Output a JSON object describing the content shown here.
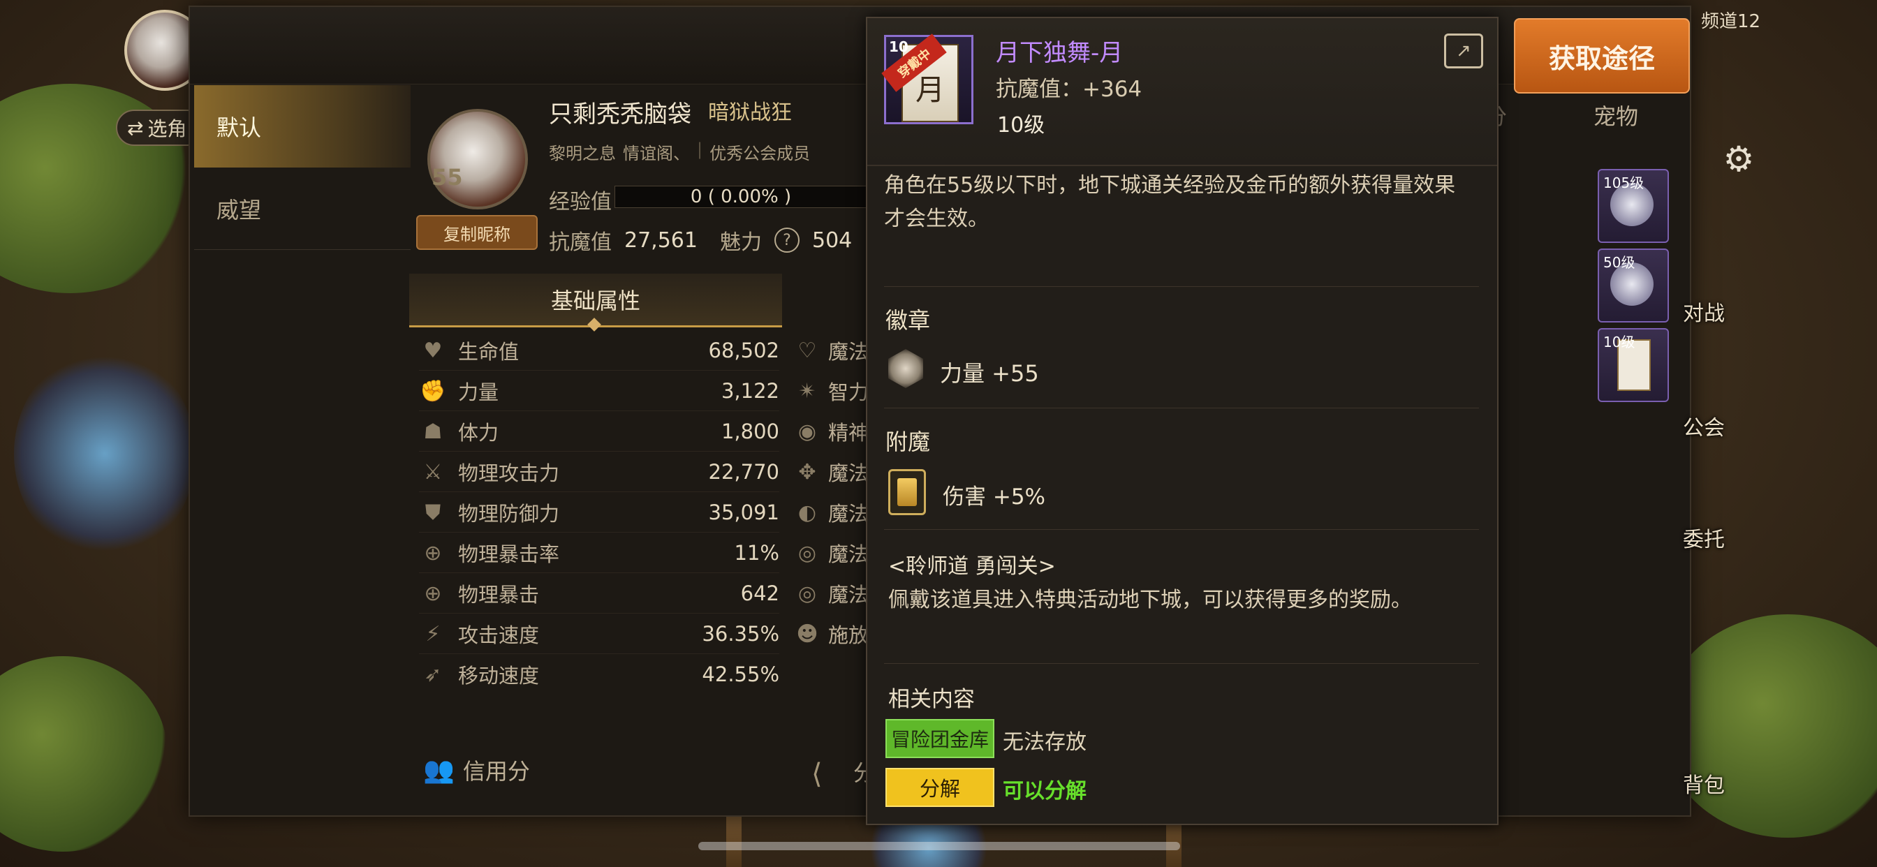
{
  "top_left": {
    "select_label": "选角"
  },
  "sidebar": {
    "tabs": [
      {
        "label": "默认"
      },
      {
        "label": "威望"
      }
    ]
  },
  "profile": {
    "level": "55",
    "copy_nickname": "复制昵称",
    "name": "只剩秃秃脑袋",
    "job": "暗狱战狂",
    "guild_info": [
      "黎明之息",
      "情谊阁、",
      "优秀公会成员"
    ],
    "exp_label": "经验值",
    "exp_value": "0 ( 0.00% )",
    "resist_label": "抗魔值",
    "resist_value": "27,561",
    "charm_label": "魅力",
    "charm_value": "504"
  },
  "attributes": {
    "tab_label": "基础属性",
    "rows": [
      {
        "label": "生命值",
        "value": "68,502",
        "icon": "heart-icon"
      },
      {
        "label": "力量",
        "value": "3,122",
        "icon": "arm-icon"
      },
      {
        "label": "体力",
        "value": "1,800",
        "icon": "person-icon"
      },
      {
        "label": "物理攻击力",
        "value": "22,770",
        "icon": "sword-icon"
      },
      {
        "label": "物理防御力",
        "value": "35,091",
        "icon": "shield-icon"
      },
      {
        "label": "物理暴击率",
        "value": "11%",
        "icon": "crosshair-icon"
      },
      {
        "label": "物理暴击",
        "value": "642",
        "icon": "crosshair-icon"
      },
      {
        "label": "攻击速度",
        "value": "36.35%",
        "icon": "attack-speed-icon"
      },
      {
        "label": "移动速度",
        "value": "42.55%",
        "icon": "boot-icon"
      }
    ],
    "right_rows": [
      "魔法",
      "智力",
      "精神",
      "魔法",
      "魔法",
      "魔法",
      "魔法",
      "施放"
    ]
  },
  "footer": {
    "credit_label": "信用分",
    "share_label": "分"
  },
  "right_panel": {
    "get_button": "获取途径",
    "channel": "频道12",
    "pet_tab": "宠物",
    "score_tab": "分",
    "slots": [
      {
        "level": "105级"
      },
      {
        "level": "50级"
      },
      {
        "level": "10级"
      }
    ],
    "side_labels": [
      "对战",
      "公会",
      "委托",
      "背包"
    ]
  },
  "tooltip": {
    "item_level_badge": "10",
    "item_ribbon": "穿戴中",
    "item_glyph": "月",
    "item_name": "月下独舞-月",
    "item_resist": "抗魔值：+364",
    "item_level": "10级",
    "description": "角色在55级以下时，地下城通关经验及金币的额外获得量效果才会生效。",
    "badge_title": "徽章",
    "badge_stat": "力量 +55",
    "enchant_title": "附魔",
    "enchant_stat": "伤害 +5%",
    "activity_title": "<聆师道 勇闯关>",
    "activity_desc": "佩戴该道具进入特典活动地下城，可以获得更多的奖励。",
    "related_title": "相关内容",
    "tag_storage": "冒险团金库",
    "tag_storage_text": "无法存放",
    "tag_disassemble": "分解",
    "tag_disassemble_text": "可以分解"
  },
  "colors": {
    "item_name": "#c28bff",
    "get_button": "#d96b1f",
    "tag_green": "#5fb82a",
    "tag_yellow": "#f0c21e",
    "disassemble_ok": "#67e02b"
  }
}
